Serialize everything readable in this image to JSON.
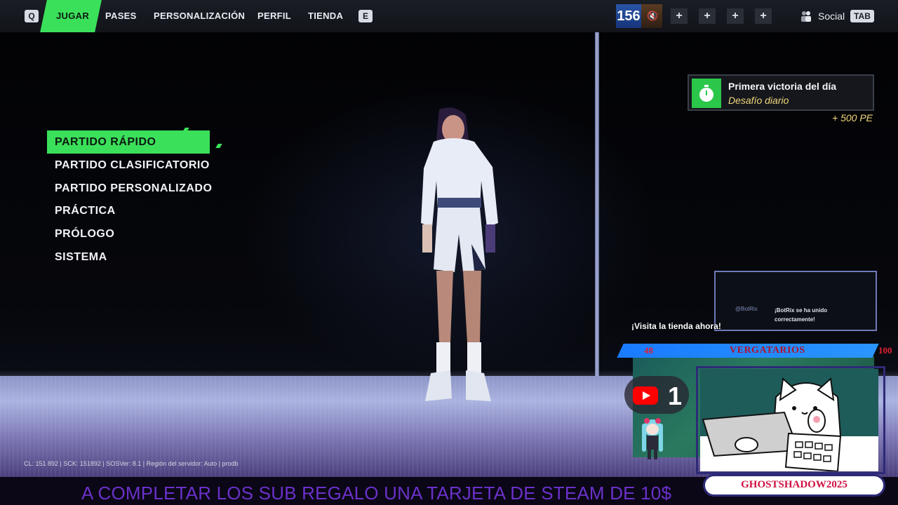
{
  "topbar": {
    "key_left": "Q",
    "key_right": "E",
    "tabs": [
      {
        "label": "JUGAR",
        "active": true
      },
      {
        "label": "PASES",
        "active": false
      },
      {
        "label": "PERSONALIZACIÓN",
        "active": false
      },
      {
        "label": "PERFIL",
        "active": false
      },
      {
        "label": "TIENDA",
        "active": false
      }
    ],
    "counter": "156",
    "plus_label": "+",
    "social_label": "Social",
    "social_key": "TAB",
    "icons": [
      "mute-icon",
      "plus-icon",
      "social-icon"
    ]
  },
  "menu": {
    "items": [
      {
        "label": "PARTIDO RÁPIDO",
        "active": true
      },
      {
        "label": "PARTIDO CLASIFICATORIO",
        "active": false
      },
      {
        "label": "PARTIDO PERSONALIZADO",
        "active": false
      },
      {
        "label": "PRÁCTICA",
        "active": false
      },
      {
        "label": "PRÓLOGO",
        "active": false
      },
      {
        "label": "SISTEMA",
        "active": false
      }
    ]
  },
  "challenge": {
    "title": "Primera victoria del día",
    "subtitle": "Desafío diario",
    "reward": "+ 500 PE",
    "icon": "stopwatch-icon"
  },
  "build_info": "CL: 151 892 | SCK: 151892 | SOSVer: 8.1 | Región del servidor: Auto | prodb",
  "overlay": {
    "chat_user": "@BotRix",
    "chat_message": "¡BotRix se ha unido correctamente!",
    "visit_text": "¡Visita la tienda ahora!",
    "goal_current": "48",
    "goal_title": "VERGATARIOS",
    "goal_target": "100",
    "youtube_count": "1",
    "streamer_name": "GHOSTSHADOW2025",
    "banner": "A COMPLETAR LOS SUB REGALO UNA TARJETA DE STEAM DE 10$"
  },
  "colors": {
    "accent_green": "#3be05a",
    "reward_yellow": "#f1d77a",
    "banner_purple": "#6a31c9",
    "goal_blue": "#2a95ff"
  }
}
